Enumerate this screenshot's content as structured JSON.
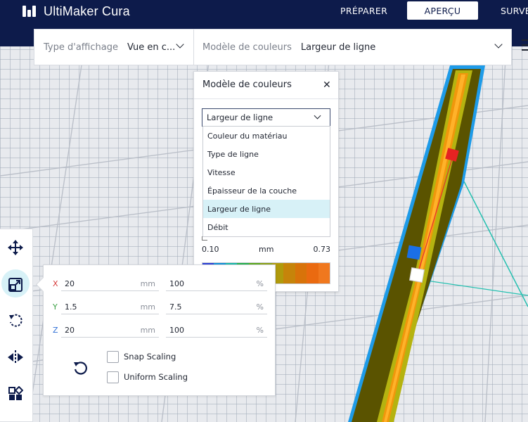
{
  "app": {
    "brand": "UltiMaker Cura"
  },
  "nav": {
    "prepare": "PRÉPARER",
    "preview": "APERÇU",
    "monitor": "SURVE"
  },
  "toolbar": {
    "view_type_label": "Type d'affichage",
    "view_type_value": "Vue en c...",
    "color_scheme_label": "Modèle de couleurs",
    "color_scheme_value": "Largeur de ligne"
  },
  "color_panel": {
    "title": "Modèle de couleurs",
    "selected": "Largeur de ligne",
    "options": [
      {
        "label": "Couleur du matériau"
      },
      {
        "label": "Type de ligne"
      },
      {
        "label": "Vitesse"
      },
      {
        "label": "Épaisseur de la couche"
      },
      {
        "label": "Largeur de ligne",
        "selected": true
      },
      {
        "label": "Débit"
      }
    ],
    "scale": {
      "min": "0.10",
      "unit": "mm",
      "max": "0.73"
    },
    "gradient_colors": [
      "#2a3fd6",
      "#0f8fd8",
      "#16b8a8",
      "#22b04a",
      "#5aa818",
      "#8aa114",
      "#b09a0c",
      "#c6840a",
      "#d8730a",
      "#ea6a10",
      "#f0781e"
    ]
  },
  "scale_panel": {
    "rows": [
      {
        "axis": "X",
        "color": "#d63a3a",
        "size": "20",
        "size_unit": "mm",
        "percent": "100",
        "percent_unit": "%"
      },
      {
        "axis": "Y",
        "color": "#3aa043",
        "size": "1.5",
        "size_unit": "mm",
        "percent": "7.5",
        "percent_unit": "%"
      },
      {
        "axis": "Z",
        "color": "#2f6fd6",
        "size": "20",
        "size_unit": "mm",
        "percent": "100",
        "percent_unit": "%"
      }
    ],
    "snap_scaling": "Snap Scaling",
    "uniform_scaling": "Uniform Scaling"
  }
}
